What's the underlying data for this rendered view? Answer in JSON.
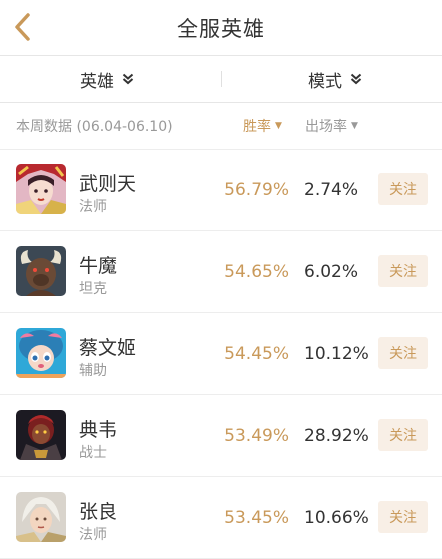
{
  "header": {
    "title": "全服英雄"
  },
  "filters": {
    "hero_label": "英雄",
    "mode_label": "模式"
  },
  "subheader": {
    "week_label": "本周数据 (06.04-06.10)",
    "winrate_sort": "胜率",
    "pickrate_sort": "出场率"
  },
  "colors": {
    "accent": "#c9995a",
    "follow_bg": "#f8efe6"
  },
  "heroes": [
    {
      "name": "武则天",
      "role": "法师",
      "win_rate": "56.79%",
      "pick_rate": "2.74%",
      "follow_label": "关注"
    },
    {
      "name": "牛魔",
      "role": "坦克",
      "win_rate": "54.65%",
      "pick_rate": "6.02%",
      "follow_label": "关注"
    },
    {
      "name": "蔡文姬",
      "role": "辅助",
      "win_rate": "54.45%",
      "pick_rate": "10.12%",
      "follow_label": "关注"
    },
    {
      "name": "典韦",
      "role": "战士",
      "win_rate": "53.49%",
      "pick_rate": "28.92%",
      "follow_label": "关注"
    },
    {
      "name": "张良",
      "role": "法师",
      "win_rate": "53.45%",
      "pick_rate": "10.66%",
      "follow_label": "关注"
    }
  ]
}
